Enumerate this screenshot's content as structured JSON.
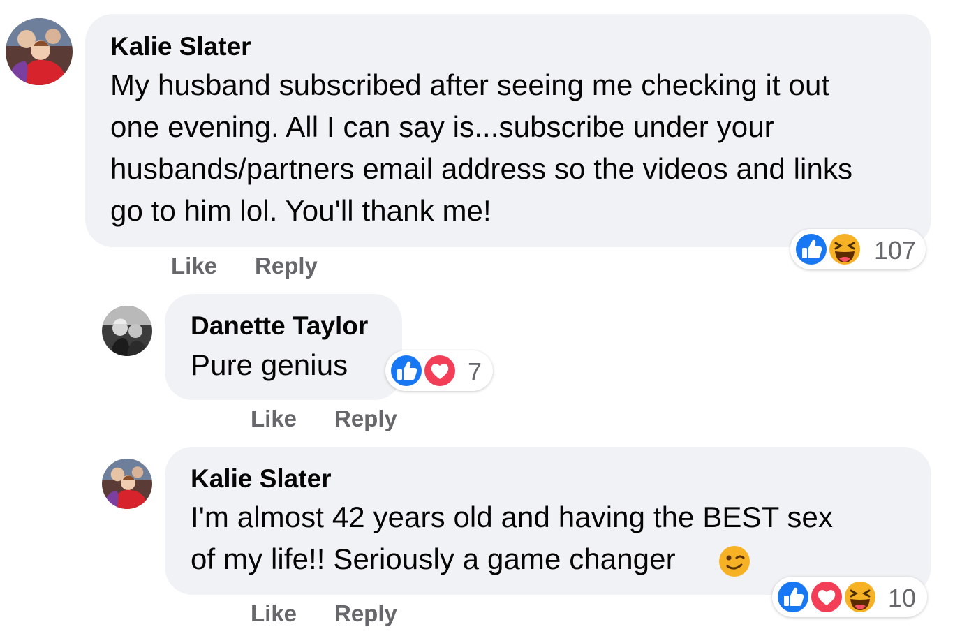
{
  "thread": {
    "comments": [
      {
        "author": "Kalie Slater",
        "avatar": "avatar-kalie",
        "lines": [
          "My husband subscribed after seeing me checking it out",
          "one evening. All I can say is...subscribe under your",
          "husbands/partners email address so the videos and links",
          "go to him lol. You'll thank me!"
        ],
        "reactions": {
          "icons": [
            "like-icon",
            "haha-icon"
          ],
          "count": "107"
        },
        "actions": {
          "like": "Like",
          "reply": "Reply"
        }
      },
      {
        "author": "Danette Taylor",
        "avatar": "avatar-danette",
        "lines": [
          "Pure genius"
        ],
        "reactions": {
          "icons": [
            "like-icon",
            "love-icon"
          ],
          "count": "7"
        },
        "actions": {
          "like": "Like",
          "reply": "Reply"
        }
      },
      {
        "author": "Kalie Slater",
        "avatar": "avatar-kalie",
        "lines": [
          "I'm almost 42 years old and having the BEST sex",
          "of my life!! Seriously a game changer"
        ],
        "inline_emoji": "wink-emoji",
        "reactions": {
          "icons": [
            "like-icon",
            "love-icon",
            "haha-icon"
          ],
          "count": "10"
        },
        "actions": {
          "like": "Like",
          "reply": "Reply"
        }
      }
    ]
  },
  "colors": {
    "bubble": "#f0f2f5",
    "secondary_text": "#65676b",
    "like_blue": "#1877f2",
    "love_red": "#f33e58",
    "haha_yellow": "#f7b125"
  }
}
